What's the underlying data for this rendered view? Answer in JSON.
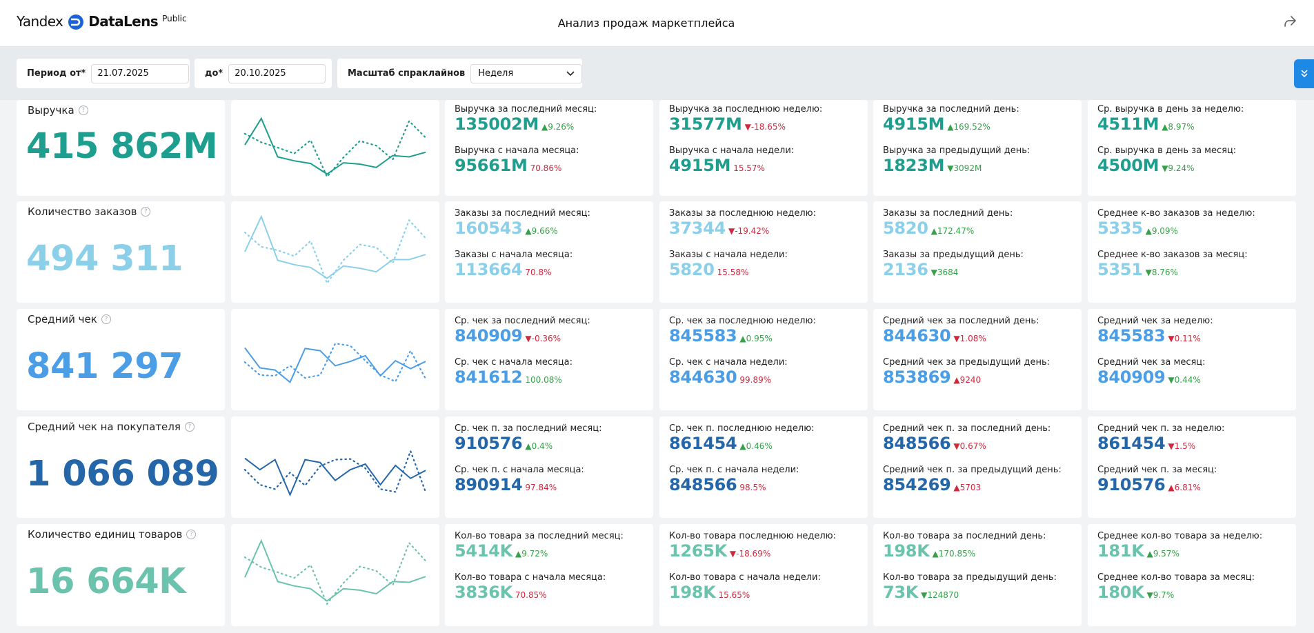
{
  "header": {
    "logo_yandex": "Yandex",
    "logo_datalens": "DataLens",
    "logo_public": "Public",
    "title": "Анализ продаж маркетплейса",
    "share_icon": "share-icon"
  },
  "filters": {
    "period_from_label": "Период от*",
    "period_from_value": "21.07.2025",
    "period_to_label": "до*",
    "period_to_value": "20.10.2025",
    "scale_label": "Масштаб спраклайнов",
    "scale_value": "Неделя",
    "collapse_icon": "double-chevron-down-icon"
  },
  "colors": {
    "revenue": "#1e9e8e",
    "orders": "#8ccfe9",
    "avg_check": "#4b9de6",
    "avg_check_customer": "#2466a8",
    "units": "#6cc3ad",
    "up": "#36a04a",
    "down": "#d0283d"
  },
  "rows": [
    {
      "title": "Выручка",
      "value": "415 862M",
      "kpis": [
        {
          "label": "Выручка за последний месяц:",
          "value": "135002M",
          "delta": "▲9.26%",
          "dir": "up",
          "label2": "Выручка с начала месяца:",
          "value2": "95661M",
          "delta2": "70.86%",
          "dir2": "neutral"
        },
        {
          "label": "Выручка за последнюю неделю:",
          "value": "31577M",
          "delta": "▼-18.65%",
          "dir": "down",
          "label2": "Выручка с начала недели:",
          "value2": "4915M",
          "delta2": "15.57%",
          "dir2": "neutral"
        },
        {
          "label": "Выручка за последний день:",
          "value": "4915M",
          "delta": "▲169.52%",
          "dir": "up",
          "label2": "Выручка за предыдущий день:",
          "value2": "1823M",
          "delta2": "▼3092M",
          "dir2": "up"
        },
        {
          "label": "Ср. выручка в день за неделю:",
          "value": "4511M",
          "delta": "▲8.97%",
          "dir": "up",
          "label2": "Ср. выручка в день за месяц:",
          "value2": "4500M",
          "delta2": "▼9.24%",
          "dir2": "up"
        }
      ]
    },
    {
      "title": "Количество заказов",
      "value": "494 311",
      "kpis": [
        {
          "label": "Заказы за последний месяц:",
          "value": "160543",
          "delta": "▲9.66%",
          "dir": "up",
          "label2": "Заказы с начала месяца:",
          "value2": "113664",
          "delta2": "70.8%",
          "dir2": "neutral"
        },
        {
          "label": "Заказы за последнюю неделю:",
          "value": "37344",
          "delta": "▼-19.42%",
          "dir": "down",
          "label2": "Заказы с начала недели:",
          "value2": "5820",
          "delta2": "15.58%",
          "dir2": "neutral"
        },
        {
          "label": "Заказы за последний день:",
          "value": "5820",
          "delta": "▲172.47%",
          "dir": "up",
          "label2": "Заказы за предыдущий день:",
          "value2": "2136",
          "delta2": "▼3684",
          "dir2": "up"
        },
        {
          "label": "Среднее к-во заказов за неделю:",
          "value": "5335",
          "delta": "▲9.09%",
          "dir": "up",
          "label2": "Среднее к-во заказов за месяц:",
          "value2": "5351",
          "delta2": "▼8.76%",
          "dir2": "up"
        }
      ]
    },
    {
      "title": "Средний чек",
      "value": "841 297",
      "kpis": [
        {
          "label": "Ср. чек за последний месяц:",
          "value": "840909",
          "delta": "▼-0.36%",
          "dir": "down",
          "label2": "Ср. чек с начала месяца:",
          "value2": "841612",
          "delta2": "100.08%",
          "dir2": "up"
        },
        {
          "label": "Ср. чек за последнюю неделю:",
          "value": "845583",
          "delta": "▲0.95%",
          "dir": "up",
          "label2": "Ср. чек с начала недели:",
          "value2": "844630",
          "delta2": "99.89%",
          "dir2": "neutral"
        },
        {
          "label": "Средний чек за последний день:",
          "value": "844630",
          "delta": "▼1.08%",
          "dir": "down",
          "label2": "Средний чек за предыдущий день:",
          "value2": "853869",
          "delta2": "▲9240",
          "dir2": "down"
        },
        {
          "label": "Средний чек за неделю:",
          "value": "845583",
          "delta": "▼0.11%",
          "dir": "down",
          "label2": "Средний чек за месяц:",
          "value2": "840909",
          "delta2": "▼0.44%",
          "dir2": "up"
        }
      ]
    },
    {
      "title": "Средний чек на покупателя",
      "value": "1 066 089",
      "kpis": [
        {
          "label": "Ср. чек п. за последний месяц:",
          "value": "910576",
          "delta": "▲0.4%",
          "dir": "up",
          "label2": "Ср. чек п. с начала месяца:",
          "value2": "890914",
          "delta2": "97.84%",
          "dir2": "neutral"
        },
        {
          "label": "Ср. чек п. последнюю неделю:",
          "value": "861454",
          "delta": "▲0.46%",
          "dir": "up",
          "label2": "Ср. чек п. с начала недели:",
          "value2": "848566",
          "delta2": "98.5%",
          "dir2": "neutral"
        },
        {
          "label": "Средний чек п. за последний день:",
          "value": "848566",
          "delta": "▼0.67%",
          "dir": "down",
          "label2": "Средний чек п. за предыдущий день:",
          "value2": "854269",
          "delta2": "▲5703",
          "dir2": "down"
        },
        {
          "label": "Средний чек п. за неделю:",
          "value": "861454",
          "delta": "▼1.5%",
          "dir": "down",
          "label2": "Средний чек п. за месяц:",
          "value2": "910576",
          "delta2": "▲6.81%",
          "dir2": "down"
        }
      ]
    },
    {
      "title": "Количество единиц товаров",
      "value": "16 664K",
      "kpis": [
        {
          "label": "Кол-во товара за последний месяц:",
          "value": "5414K",
          "delta": "▲9.72%",
          "dir": "up",
          "label2": "Кол-во товара с начала месяца:",
          "value2": "3836K",
          "delta2": "70.85%",
          "dir2": "neutral"
        },
        {
          "label": "Кол-во товара последнюю неделю:",
          "value": "1265K",
          "delta": "▼-18.69%",
          "dir": "down",
          "label2": "Кол-во товара с начала недели:",
          "value2": "198K",
          "delta2": "15.65%",
          "dir2": "neutral"
        },
        {
          "label": "Кол-во товара за последний день:",
          "value": "198K",
          "delta": "▲170.85%",
          "dir": "up",
          "label2": "Кол-во товара за предыдущий день:",
          "value2": "73K",
          "delta2": "▼124870",
          "dir2": "up"
        },
        {
          "label": "Среднее кол-во товара за неделю:",
          "value": "181K",
          "delta": "▲9.57%",
          "dir": "up",
          "label2": "Среднее кол-во товара за месяц:",
          "value2": "180K",
          "delta2": "▼9.7%",
          "dir2": "up"
        }
      ]
    }
  ],
  "sparklines": [
    {
      "solid": [
        0.45,
        0.05,
        0.63,
        0.69,
        0.73,
        0.89,
        0.72,
        0.74,
        0.79,
        0.61,
        0.63,
        0.56
      ],
      "dotted": [
        0.28,
        0.41,
        0.49,
        0.58,
        0.38,
        0.93,
        0.64,
        0.39,
        0.46,
        0.67,
        0.09,
        0.34
      ]
    },
    {
      "solid": [
        0.51,
        0.02,
        0.63,
        0.69,
        0.73,
        0.88,
        0.71,
        0.74,
        0.79,
        0.62,
        0.62,
        0.55
      ],
      "dotted": [
        0.24,
        0.44,
        0.49,
        0.57,
        0.36,
        0.95,
        0.63,
        0.41,
        0.45,
        0.67,
        0.07,
        0.32
      ]
    },
    {
      "solid": [
        0.35,
        0.63,
        0.66,
        0.83,
        0.36,
        0.39,
        0.6,
        0.54,
        0.46,
        0.74,
        0.53,
        0.64,
        0.54
      ],
      "dotted": [
        0.55,
        0.73,
        0.74,
        0.6,
        0.77,
        0.73,
        0.29,
        0.32,
        0.53,
        0.73,
        0.82,
        0.39,
        0.78
      ]
    },
    {
      "solid": [
        0.39,
        0.55,
        0.41,
        0.9,
        0.41,
        0.45,
        0.7,
        0.55,
        0.47,
        0.76,
        0.49,
        0.67,
        0.56
      ],
      "dotted": [
        0.55,
        0.76,
        0.82,
        0.59,
        0.77,
        0.5,
        0.41,
        0.4,
        0.53,
        0.82,
        0.86,
        0.29,
        0.86
      ]
    },
    {
      "solid": [
        0.55,
        0.04,
        0.61,
        0.67,
        0.71,
        0.88,
        0.71,
        0.73,
        0.78,
        0.61,
        0.62,
        0.54
      ],
      "dotted": [
        0.27,
        0.41,
        0.48,
        0.56,
        0.38,
        0.92,
        0.63,
        0.4,
        0.46,
        0.66,
        0.07,
        0.32
      ]
    }
  ]
}
